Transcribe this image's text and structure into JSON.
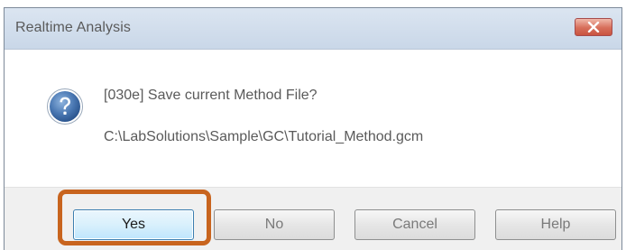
{
  "window": {
    "title": "Realtime Analysis",
    "close_icon": "close-icon"
  },
  "message": {
    "icon": "question-icon",
    "line1": "[030e] Save current Method File?",
    "line2": "C:\\LabSolutions\\Sample\\GC\\Tutorial_Method.gcm"
  },
  "buttons": {
    "yes": "Yes",
    "no": "No",
    "cancel": "Cancel",
    "help": "Help"
  },
  "colors": {
    "highlight": "#c8641e",
    "close_button": "#d76e5a",
    "focused_button_border": "#3c7fb1"
  }
}
